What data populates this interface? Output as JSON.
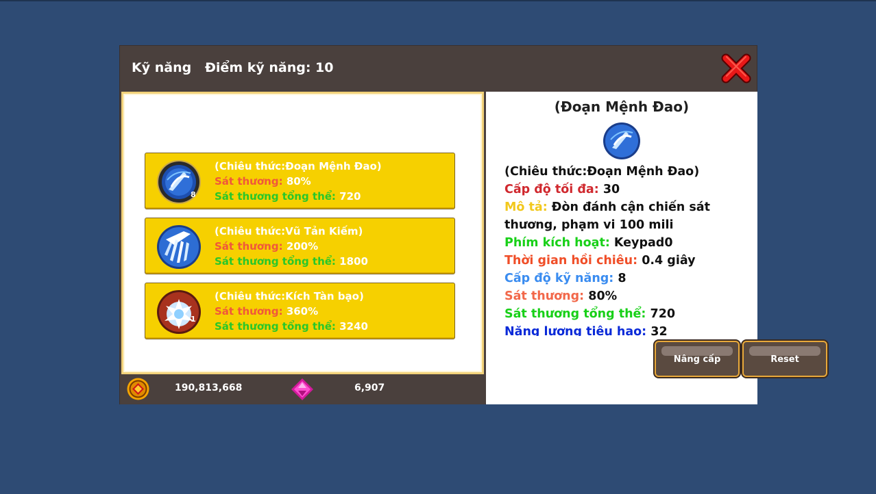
{
  "header": {
    "title": "Kỹ năng",
    "skill_points": "Điểm kỹ năng: 10"
  },
  "skills": [
    {
      "name": "(Chiêu thức:Đoạn Mệnh Đao)",
      "damage_label": "Sát thương:",
      "damage_value": "80%",
      "total_label": "Sát thương tổng thể:",
      "total_value": "720",
      "level": "8",
      "icon": "blade-slash-icon"
    },
    {
      "name": "(Chiêu thức:Vũ Tản Kiếm)",
      "damage_label": "Sát thương:",
      "damage_value": "200%",
      "total_label": "Sát thương tổng thể:",
      "total_value": "1800",
      "icon": "sword-rain-icon"
    },
    {
      "name": "(Chiêu thức:Kích Tàn bạo)",
      "damage_label": "Sát thương:",
      "damage_value": "360%",
      "total_label": "Sát thương tổng thể:",
      "total_value": "3240",
      "level": "1",
      "icon": "brutal-strike-icon"
    }
  ],
  "currency": {
    "gold": "190,813,668",
    "gems": "6,907",
    "gold_icon": "gold-coin-icon",
    "gem_icon": "pink-gem-icon"
  },
  "detail": {
    "title": "(Đoạn Mệnh Đao)",
    "skill_name": "(Chiêu thức:Đoạn Mệnh Đao)",
    "max_level_label": "Cấp độ tối đa:",
    "max_level_value": "30",
    "desc_label": "Mô tả:",
    "desc_value_1": "Đòn đánh cận chiến sát",
    "desc_value_2": "thương, phạm vi 100 mili",
    "hotkey_label": "Phím kích hoạt:",
    "hotkey_value": "Keypad0",
    "cooldown_label": "Thời gian hồi chiêu:",
    "cooldown_value": "0.4 giây",
    "skill_level_label": "Cấp độ kỹ năng:",
    "skill_level_value": "8",
    "damage_label": "Sát thương:",
    "damage_value": "80%",
    "total_label": "Sát thương tổng thể:",
    "total_value": "720",
    "energy_label": "Năng lượng tiêu hao:",
    "energy_value": "32"
  },
  "buttons": {
    "upgrade": "Nâng cấp",
    "reset": "Reset"
  },
  "colors": {
    "background": "#2e4b74",
    "panel": "#4a403d",
    "card": "#f6d000",
    "damage": "#f0573b",
    "total": "#28c72a"
  }
}
